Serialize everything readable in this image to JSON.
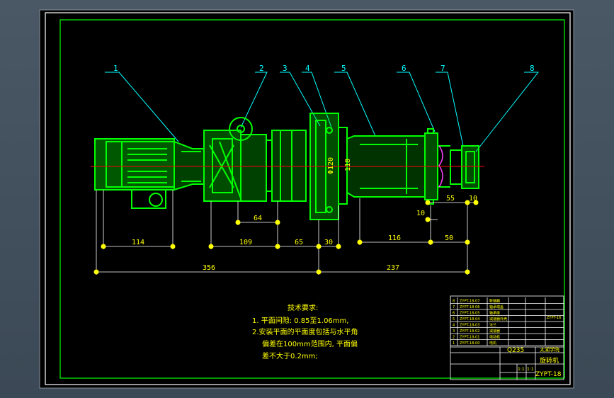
{
  "drawing": {
    "colors": {
      "background": "#000000",
      "frame": "#ffffff",
      "part": "#00ff00",
      "leader": "#00ffff",
      "dimension": "#ffffff",
      "centerline": "#ff0000",
      "text": "#ffff00",
      "viewport": "#4a5866"
    },
    "balloons": [
      "1",
      "2",
      "3",
      "4",
      "5",
      "6",
      "7",
      "8"
    ],
    "dimensions": {
      "d114": "114",
      "d109": "109",
      "d64": "64",
      "d65": "65",
      "d30": "30",
      "d116": "116",
      "d50": "50",
      "d55": "55",
      "d10a": "10",
      "d10b": "10",
      "d356": "356",
      "d237": "237",
      "phi120": "Φ120",
      "d118": "118"
    },
    "notes": {
      "title": "技术要求:",
      "line1": "1. 平面间隙: 0.85至1.06mm,",
      "line2": "2.安装平面的平面度包括与水平角",
      "line3": "偏差在100mm范围内, 平面偏",
      "line4": "差不大于0.2mm;"
    },
    "title_block": {
      "material": "Q235",
      "school": "太湖学院",
      "name": "旋转机",
      "code": "ZYPT-18",
      "side_note": "ZYPT-16",
      "scale_a": "1:1",
      "scale_b": "1:1",
      "bom_rows": [
        {
          "no": "8",
          "code": "ZYPT-18-07",
          "name": "联轴器"
        },
        {
          "no": "7",
          "code": "ZYPT-18-06",
          "name": "轴承端盖"
        },
        {
          "no": "6",
          "code": "ZYPT-18-05",
          "name": "轴承座"
        },
        {
          "no": "5",
          "code": "ZYPT-18-04",
          "name": "减速器外壳"
        },
        {
          "no": "4",
          "code": "ZYPT-18-03",
          "name": "法兰"
        },
        {
          "no": "3",
          "code": "ZYPT-18-02",
          "name": "减速器"
        },
        {
          "no": "2",
          "code": "ZYPT-18-01",
          "name": "电动机"
        },
        {
          "no": "1",
          "code": "ZYPT-18-00",
          "name": "电机"
        }
      ]
    }
  }
}
